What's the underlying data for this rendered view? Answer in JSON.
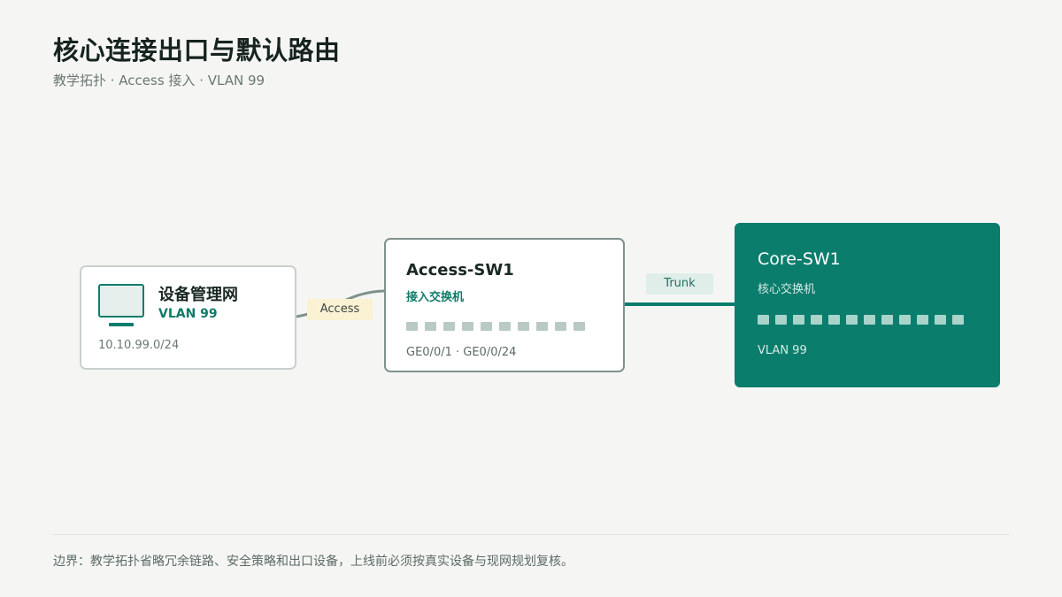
{
  "header": {
    "title": "核心连接出口与默认路由",
    "subtitle": "教学拓扑 · Access 接入 · VLAN 99"
  },
  "links": {
    "access_label": "Access",
    "trunk_label": "Trunk"
  },
  "host": {
    "name": "设备管理网",
    "vlan": "VLAN 99",
    "subnet": "10.10.99.0/24"
  },
  "access_switch": {
    "name": "Access-SW1",
    "role": "接入交换机",
    "port_count": 10,
    "port_range": "GE0/0/1 · GE0/0/24"
  },
  "core_switch": {
    "name": "Core-SW1",
    "role": "核心交换机",
    "port_count": 12,
    "vlan": "VLAN 99"
  },
  "footer": {
    "note": "边界：教学拓扑省略冗余链路、安全策略和出口设备，上线前必须按真实设备与现网规划复核。"
  },
  "colors": {
    "accent": "#0b7d6d",
    "access_link": "#7f928b",
    "access_tag_bg": "#fbf1d3",
    "trunk_tag_bg": "#dfeee9"
  }
}
